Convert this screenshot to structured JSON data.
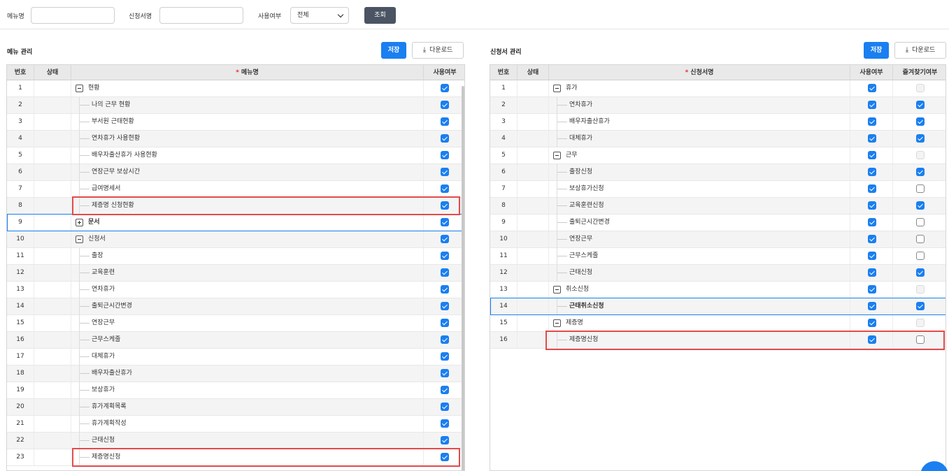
{
  "search": {
    "menu_label": "메뉴명",
    "form_label": "신청서명",
    "use_label": "사용여부",
    "use_selected": "전체",
    "search_button": "조회"
  },
  "left": {
    "title": "메뉴 관리",
    "save": "저장",
    "download": "다운로드",
    "headers": {
      "no": "번호",
      "status": "상태",
      "required_mark": "*",
      "name": "메뉴명",
      "use": "사용여부"
    },
    "rows": [
      {
        "no": "1",
        "name": "현황",
        "level": 0,
        "toggle": "minus",
        "use": true
      },
      {
        "no": "2",
        "name": "나의 근무 현황",
        "level": 1,
        "use": true
      },
      {
        "no": "3",
        "name": "부서원 근태현황",
        "level": 1,
        "use": true
      },
      {
        "no": "4",
        "name": "연차휴가 사용현황",
        "level": 1,
        "use": true
      },
      {
        "no": "5",
        "name": "배우자출산휴가 사용현황",
        "level": 1,
        "use": true
      },
      {
        "no": "6",
        "name": "연장근무 보상시간",
        "level": 1,
        "use": true
      },
      {
        "no": "7",
        "name": "급여명세서",
        "level": 1,
        "use": true
      },
      {
        "no": "8",
        "name": "제증명 신청현황",
        "level": 1,
        "use": true
      },
      {
        "no": "9",
        "name": "문서",
        "level": 0,
        "toggle": "plus",
        "use": true,
        "selected": true
      },
      {
        "no": "10",
        "name": "신청서",
        "level": 0,
        "toggle": "minus",
        "use": true
      },
      {
        "no": "11",
        "name": "출장",
        "level": 1,
        "use": true
      },
      {
        "no": "12",
        "name": "교육훈련",
        "level": 1,
        "use": true
      },
      {
        "no": "13",
        "name": "연차휴가",
        "level": 1,
        "use": true
      },
      {
        "no": "14",
        "name": "출퇴근시간변경",
        "level": 1,
        "use": true
      },
      {
        "no": "15",
        "name": "연장근무",
        "level": 1,
        "use": true
      },
      {
        "no": "16",
        "name": "근무스케줄",
        "level": 1,
        "use": true
      },
      {
        "no": "17",
        "name": "대체휴가",
        "level": 1,
        "use": true
      },
      {
        "no": "18",
        "name": "배우자출산휴가",
        "level": 1,
        "use": true
      },
      {
        "no": "19",
        "name": "보상휴가",
        "level": 1,
        "use": true
      },
      {
        "no": "20",
        "name": "휴가계획목록",
        "level": 1,
        "use": true
      },
      {
        "no": "21",
        "name": "휴가계획작성",
        "level": 1,
        "use": true
      },
      {
        "no": "22",
        "name": "근태신청",
        "level": 1,
        "use": true
      },
      {
        "no": "23",
        "name": "제증명신청",
        "level": 1,
        "use": true
      }
    ]
  },
  "right": {
    "title": "신청서 관리",
    "save": "저장",
    "download": "다운로드",
    "headers": {
      "no": "번호",
      "status": "상태",
      "required_mark": "*",
      "name": "신청서명",
      "use": "사용여부",
      "fav": "즐겨찾기여부"
    },
    "rows": [
      {
        "no": "1",
        "name": "휴가",
        "level": 0,
        "toggle": "minus",
        "use": true,
        "fav": "dis"
      },
      {
        "no": "2",
        "name": "연차휴가",
        "level": 1,
        "use": true,
        "fav": "on"
      },
      {
        "no": "3",
        "name": "배우자출산휴가",
        "level": 1,
        "use": true,
        "fav": "on"
      },
      {
        "no": "4",
        "name": "대체휴가",
        "level": 1,
        "use": true,
        "fav": "on"
      },
      {
        "no": "5",
        "name": "근무",
        "level": 0,
        "toggle": "minus",
        "use": true,
        "fav": "dis"
      },
      {
        "no": "6",
        "name": "출장신청",
        "level": 1,
        "use": true,
        "fav": "on"
      },
      {
        "no": "7",
        "name": "보상휴가신청",
        "level": 1,
        "use": true,
        "fav": "off"
      },
      {
        "no": "8",
        "name": "교육훈련신청",
        "level": 1,
        "use": true,
        "fav": "on"
      },
      {
        "no": "9",
        "name": "출퇴근시간변경",
        "level": 1,
        "use": true,
        "fav": "off"
      },
      {
        "no": "10",
        "name": "연장근무",
        "level": 1,
        "use": true,
        "fav": "off"
      },
      {
        "no": "11",
        "name": "근무스케줄",
        "level": 1,
        "use": true,
        "fav": "off"
      },
      {
        "no": "12",
        "name": "근태신청",
        "level": 1,
        "use": true,
        "fav": "on"
      },
      {
        "no": "13",
        "name": "취소신청",
        "level": 0,
        "toggle": "minus",
        "use": true,
        "fav": "dis"
      },
      {
        "no": "14",
        "name": "근태취소신청",
        "level": 1,
        "use": true,
        "fav": "on",
        "selected": true
      },
      {
        "no": "15",
        "name": "제증명",
        "level": 0,
        "toggle": "minus",
        "use": true,
        "fav": "dis"
      },
      {
        "no": "16",
        "name": "제증명신청",
        "level": 1,
        "use": true,
        "fav": "off"
      }
    ]
  },
  "colors": {
    "accent": "#1a7ff0",
    "highlight": "#e34b4b",
    "dark_button": "#4a5463"
  }
}
